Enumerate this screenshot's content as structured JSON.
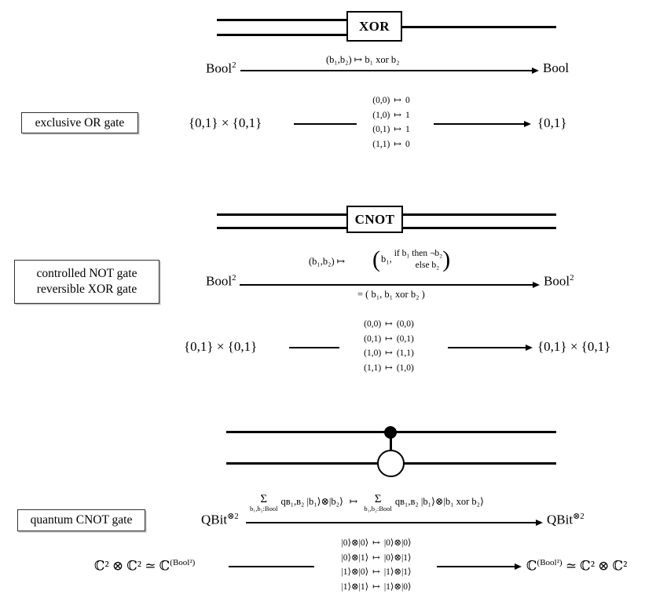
{
  "document": {
    "title": "XOR / CNOT gate correspondence diagram",
    "ink_color": "#000000"
  },
  "sections": [
    {
      "id": "xor",
      "caption_lines": [
        "exclusive OR gate"
      ],
      "gate_label": "XOR",
      "circuit": {
        "inputs": 2,
        "outputs": 1,
        "style": "labelled-box"
      },
      "type_arrow": {
        "domain": "Bool",
        "domain_sup": "2",
        "codomain": "Bool",
        "codomain_sup": "",
        "label_above": "(b₁,b₂)  ↦  b₁ xor b₂"
      },
      "set_arrow": {
        "domain": "{0,1} × {0,1}",
        "codomain": "{0,1}"
      },
      "table": [
        {
          "from": "(0,0)",
          "to": "0"
        },
        {
          "from": "(1,0)",
          "to": "1"
        },
        {
          "from": "(0,1)",
          "to": "1"
        },
        {
          "from": "(1,1)",
          "to": "0"
        }
      ]
    },
    {
      "id": "cnot",
      "caption_lines": [
        "controlled NOT gate",
        "reversible XOR gate"
      ],
      "gate_label": "CNOT",
      "circuit": {
        "inputs": 2,
        "outputs": 2,
        "style": "labelled-box"
      },
      "type_arrow": {
        "domain": "Bool",
        "domain_sup": "2",
        "codomain": "Bool",
        "codomain_sup": "2",
        "label_prefix": "(b₁,b₂)  ↦",
        "label_pair_first": "b₁,",
        "label_cond_line1": "if b₁ then ¬b₂",
        "label_cond_line2": "else  b₂",
        "label_below": "= ( b₁,  b₁ xor b₂ )"
      },
      "set_arrow": {
        "domain": "{0,1} × {0,1}",
        "codomain": "{0,1} × {0,1}"
      },
      "table": [
        {
          "from": "(0,0)",
          "to": "(0,0)"
        },
        {
          "from": "(0,1)",
          "to": "(0,1)"
        },
        {
          "from": "(1,0)",
          "to": "(1,1)"
        },
        {
          "from": "(1,1)",
          "to": "(1,0)"
        }
      ]
    },
    {
      "id": "quantum-cnot",
      "caption_lines": [
        "quantum CNOT gate"
      ],
      "gate_label": "",
      "circuit": {
        "inputs": 2,
        "outputs": 2,
        "style": "control-target"
      },
      "type_arrow": {
        "domain": "QBit",
        "domain_sup": "⊗2",
        "codomain": "QBit",
        "codomain_sup": "⊗2",
        "sum_symbol": "Σ",
        "sum_subscript": "b₁,b₂:Bool",
        "lhs_term": "qʙ₁,ʙ₂ |b₁⟩⊗|b₂⟩",
        "maps_to": "↦",
        "rhs_term": "qʙ₁,ʙ₂ |b₁⟩⊗|b₁ xor b₂⟩"
      },
      "set_arrow": {
        "domain": "ℂ² ⊗ ℂ²  ≃ ℂ",
        "domain_sup": "(Bool²)",
        "codomain": "ℂ",
        "codomain_sup": "(Bool²)",
        "codomain_tail": " ≃ ℂ² ⊗ ℂ²"
      },
      "table": [
        {
          "from": "|0⟩⊗|0⟩",
          "to": "|0⟩⊗|0⟩"
        },
        {
          "from": "|0⟩⊗|1⟩",
          "to": "|0⟩⊗|1⟩"
        },
        {
          "from": "|1⟩⊗|0⟩",
          "to": "|1⟩⊗|1⟩"
        },
        {
          "from": "|1⟩⊗|1⟩",
          "to": "|1⟩⊗|0⟩"
        }
      ]
    }
  ]
}
